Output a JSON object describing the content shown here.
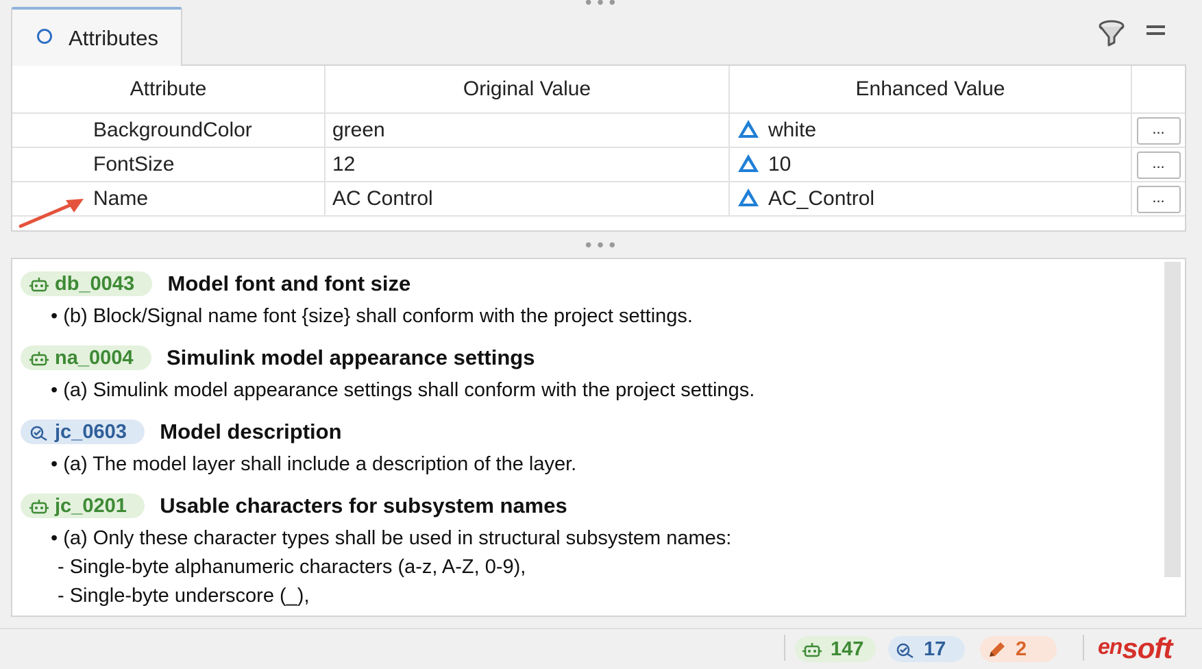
{
  "window": {
    "tab_label": "Attributes"
  },
  "toolbar": {
    "filter_icon": "filter-funnel-icon",
    "menu_icon": "hamburger-menu-icon"
  },
  "attributes_table": {
    "headers": [
      "Attribute",
      "Original Value",
      "Enhanced Value"
    ],
    "rows": [
      {
        "attribute": "BackgroundColor",
        "original": "green",
        "enhanced": "white",
        "button": "..."
      },
      {
        "attribute": "FontSize",
        "original": "12",
        "enhanced": "10",
        "button": "..."
      },
      {
        "attribute": "Name",
        "original": "AC Control",
        "enhanced": "AC_Control",
        "button": "..."
      }
    ],
    "delta_icon": "delta-icon",
    "delta_color": "#1f7fd6",
    "annotation_arrow_color": "#e5533d"
  },
  "rules": [
    {
      "id": "db_0043",
      "style": "green",
      "icon": "robot-icon",
      "title": "Model font and font size",
      "lines": [
        "• (b) Block/Signal name font {size} shall conform with the project settings."
      ]
    },
    {
      "id": "na_0004",
      "style": "green",
      "icon": "robot-icon",
      "title": "Simulink model appearance settings",
      "lines": [
        "• (a) Simulink model appearance settings shall conform with the project settings."
      ]
    },
    {
      "id": "jc_0603",
      "style": "blue",
      "icon": "review-icon",
      "title": "Model description",
      "lines": [
        "• (a) The model layer shall include a description of the layer."
      ]
    },
    {
      "id": "jc_0201",
      "style": "green",
      "icon": "robot-icon",
      "title": "Usable characters for subsystem names",
      "lines": [
        "• (a) Only these character types shall be used in structural subsystem names:",
        "- Single-byte alphanumeric characters (a-z, A-Z, 0-9),",
        "- Single-byte underscore (_),"
      ]
    }
  ],
  "statusbar": {
    "automatic_count": "147",
    "review_count": "17",
    "manual_count": "2",
    "logo_text_en": "en",
    "logo_text_soft": "soft",
    "colors": {
      "green": "#3e8a35",
      "blue": "#2f5f9a",
      "orange": "#d9652a",
      "logo": "#d6302a"
    }
  }
}
